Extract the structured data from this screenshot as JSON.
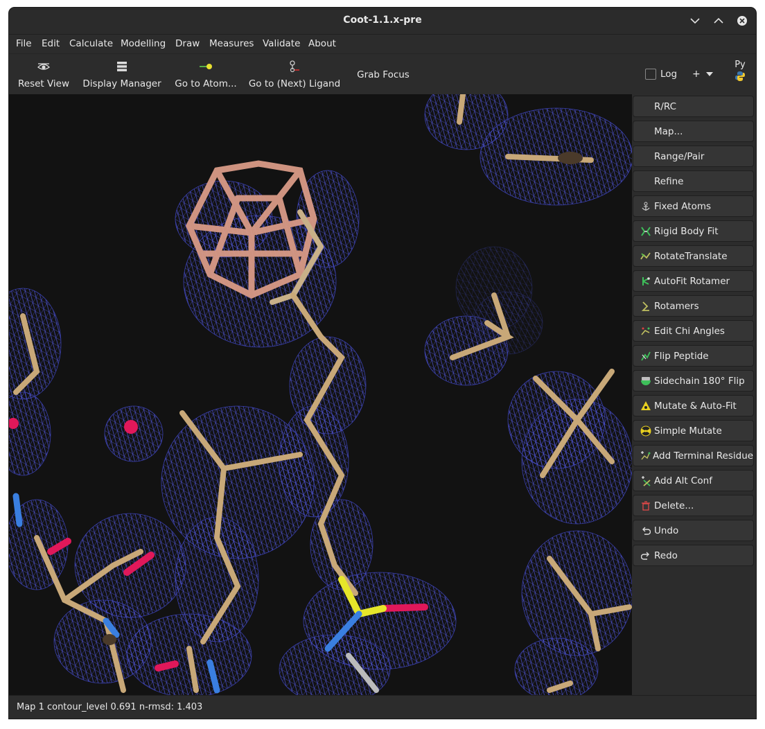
{
  "window": {
    "title": "Coot-1.1.x-pre"
  },
  "menu": [
    "File",
    "Edit",
    "Calculate",
    "Modelling",
    "Draw",
    "Measures",
    "Validate",
    "About"
  ],
  "toolbar": {
    "reset_view": "Reset View",
    "display_manager": "Display Manager",
    "go_to_atom": "Go to Atom...",
    "go_to_ligand": "Go to (Next) Ligand",
    "grab_focus": "Grab Focus",
    "log_label": "Log",
    "log_checked": false,
    "plus_label": "+",
    "py_label": "Py"
  },
  "sidebar": [
    {
      "label": "R/RC",
      "icon": ""
    },
    {
      "label": "Map...",
      "icon": ""
    },
    {
      "label": "Range/Pair",
      "icon": ""
    },
    {
      "label": "Refine",
      "icon": ""
    },
    {
      "label": "Fixed Atoms",
      "icon": "anchor-icon"
    },
    {
      "label": "Rigid Body Fit",
      "icon": "rigid-body-fit-icon"
    },
    {
      "label": "RotateTranslate",
      "icon": "rotate-translate-icon"
    },
    {
      "label": "AutoFit Rotamer",
      "icon": "autofit-rotamer-icon"
    },
    {
      "label": "Rotamers",
      "icon": "rotamers-icon"
    },
    {
      "label": "Edit Chi Angles",
      "icon": "edit-chi-angles-icon"
    },
    {
      "label": "Flip Peptide",
      "icon": "flip-peptide-icon"
    },
    {
      "label": "Sidechain 180° Flip",
      "icon": "sidechain-flip-icon"
    },
    {
      "label": "Mutate & Auto-Fit",
      "icon": "mutate-autofit-icon"
    },
    {
      "label": "Simple Mutate",
      "icon": "simple-mutate-icon"
    },
    {
      "label": "Add Terminal Residue",
      "icon": "add-terminal-residue-icon"
    },
    {
      "label": "Add Alt Conf",
      "icon": "add-alt-conf-icon"
    },
    {
      "label": "Delete...",
      "icon": "trash-icon"
    },
    {
      "label": "Undo",
      "icon": "undo-icon"
    },
    {
      "label": "Redo",
      "icon": "redo-icon"
    }
  ],
  "status": {
    "text": "Map 1  contour_level 0.691  n-rmsd: 1.403"
  },
  "colors": {
    "background": "#121212",
    "mesh": "#4a50c8",
    "carbon": "#c8a878",
    "ligand_carbon": "#d99a86",
    "oxygen": "#e0185a",
    "nitrogen": "#3a7fe0",
    "sulfur": "#e6e62a"
  }
}
